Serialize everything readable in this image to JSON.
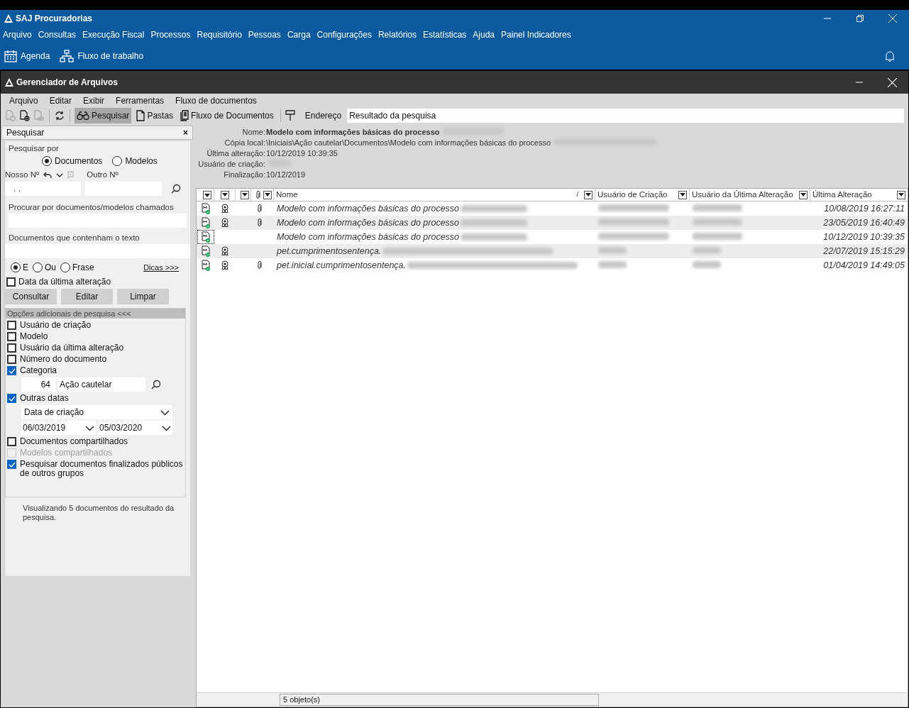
{
  "app": {
    "title": "SAJ Procuradorias",
    "menu": [
      "Arquivo",
      "Consultas",
      "Execução Fiscal",
      "Processos",
      "Requisitório",
      "Pessoas",
      "Carga",
      "Configurações",
      "Relatórios",
      "Estatísticas",
      "Ajuda",
      "Painel Indicadores"
    ],
    "toolbar": [
      {
        "label": "Agenda",
        "kind": "calendar"
      },
      {
        "label": "Fluxo de trabalho",
        "kind": "flow"
      }
    ]
  },
  "window": {
    "title": "Gerenciador de Arquivos",
    "menu": [
      "Arquivo",
      "Editar",
      "Exibir",
      "Ferramentas",
      "Fluxo de documentos"
    ],
    "tabs": [
      {
        "label": "Pesquisar",
        "kind": "binoculars",
        "selected": true
      },
      {
        "label": "Pastas",
        "kind": "folder",
        "selected": false
      },
      {
        "label": "Fluxo de Documentos",
        "kind": "docs",
        "selected": false
      }
    ],
    "address_label": "Endereço",
    "address": "Resultado da pesquisa"
  },
  "search": {
    "title": "Pesquisar",
    "close": "×",
    "by_label": "Pesquisar por",
    "by": [
      {
        "label": "Documentos",
        "selected": true
      },
      {
        "label": "Modelos",
        "selected": false
      }
    ],
    "nosso_label": "Nosso Nº",
    "nosso_value": ". .",
    "outro_label": "Outro Nº",
    "name_label": "Procurar por documentos/modelos chamados",
    "text_label": "Documentos que contenham o texto",
    "mode": [
      {
        "label": "E",
        "selected": true
      },
      {
        "label": "Ou",
        "selected": false
      },
      {
        "label": "Frase",
        "selected": false
      }
    ],
    "tips": "Dicas >>>",
    "date_check": {
      "label": "Data da última alteração",
      "checked": false
    },
    "buttons": [
      "Consultar",
      "Editar",
      "Limpar"
    ],
    "options_title": "Opções adicionais de pesquisa <<<",
    "options": [
      {
        "kind": "checkbox",
        "label": "Usuário de criação",
        "checked": false,
        "disabled": false
      },
      {
        "kind": "checkbox",
        "label": "Modelo",
        "checked": false,
        "disabled": false
      },
      {
        "kind": "checkbox",
        "label": "Usuário da última alteração",
        "checked": false,
        "disabled": false
      },
      {
        "kind": "checkbox",
        "label": "Número do documento",
        "checked": false,
        "disabled": false
      },
      {
        "kind": "checkbox",
        "label": "Categoria",
        "checked": true,
        "disabled": false
      },
      {
        "kind": "category",
        "code": "64",
        "value": "Ação cautelar"
      },
      {
        "kind": "checkbox",
        "label": "Outras datas",
        "checked": true,
        "disabled": false
      },
      {
        "kind": "dates",
        "type": "Data de criação",
        "from": "06/03/2019",
        "to": "05/03/2020"
      },
      {
        "kind": "checkbox",
        "label": "Documentos compartilhados",
        "checked": false,
        "disabled": false
      },
      {
        "kind": "checkbox",
        "label": "Modelos compartilhados",
        "checked": false,
        "disabled": true
      },
      {
        "kind": "checkbox",
        "label": "Pesquisar documentos finalizados públicos de outros grupos",
        "checked": true,
        "disabled": false
      }
    ],
    "summary": "Visualizando 5 documentos do resultado da pesquisa."
  },
  "details": {
    "name": {
      "label": "Nome:",
      "value": "Modelo com informações básicas do processo"
    },
    "fields": [
      {
        "label": "Cópia local:",
        "value": "\\Iniciais\\Ação cautelar\\Documentos\\Modelo com informações básicas do processo"
      },
      {
        "label": "Última alteração:",
        "value": "10/12/2019 10:39:35"
      },
      {
        "label": "Usuário de criação:"
      },
      {
        "label": "Finalização:",
        "value": "10/12/2019"
      }
    ]
  },
  "table": {
    "columns": [
      "Nome",
      "Usuário de Criação",
      "Usuário da Última Alteração",
      "Última Alteração"
    ],
    "sort_mark": "/",
    "rows": [
      {
        "name": "Modelo com informações básicas do processo",
        "certified": true,
        "attachment": true,
        "modified": "10/08/2019 16:27:11",
        "selected": false
      },
      {
        "name": "Modelo com informações básicas do processo",
        "certified": true,
        "attachment": true,
        "modified": "23/05/2019 16:40:49",
        "selected": false
      },
      {
        "name": "Modelo com informações básicas do processo",
        "certified": false,
        "attachment": false,
        "modified": "10/12/2019 10:39:35",
        "selected": true
      },
      {
        "name": "pet.cumprimentosentença.",
        "certified": true,
        "attachment": false,
        "modified": "22/07/2019 15:15:29",
        "selected": false
      },
      {
        "name": "pet.inicial.cumprimentosentença.",
        "certified": true,
        "attachment": true,
        "modified": "01/04/2019 14:49:05",
        "selected": false
      }
    ]
  },
  "status_bar": "5 objeto(s)"
}
